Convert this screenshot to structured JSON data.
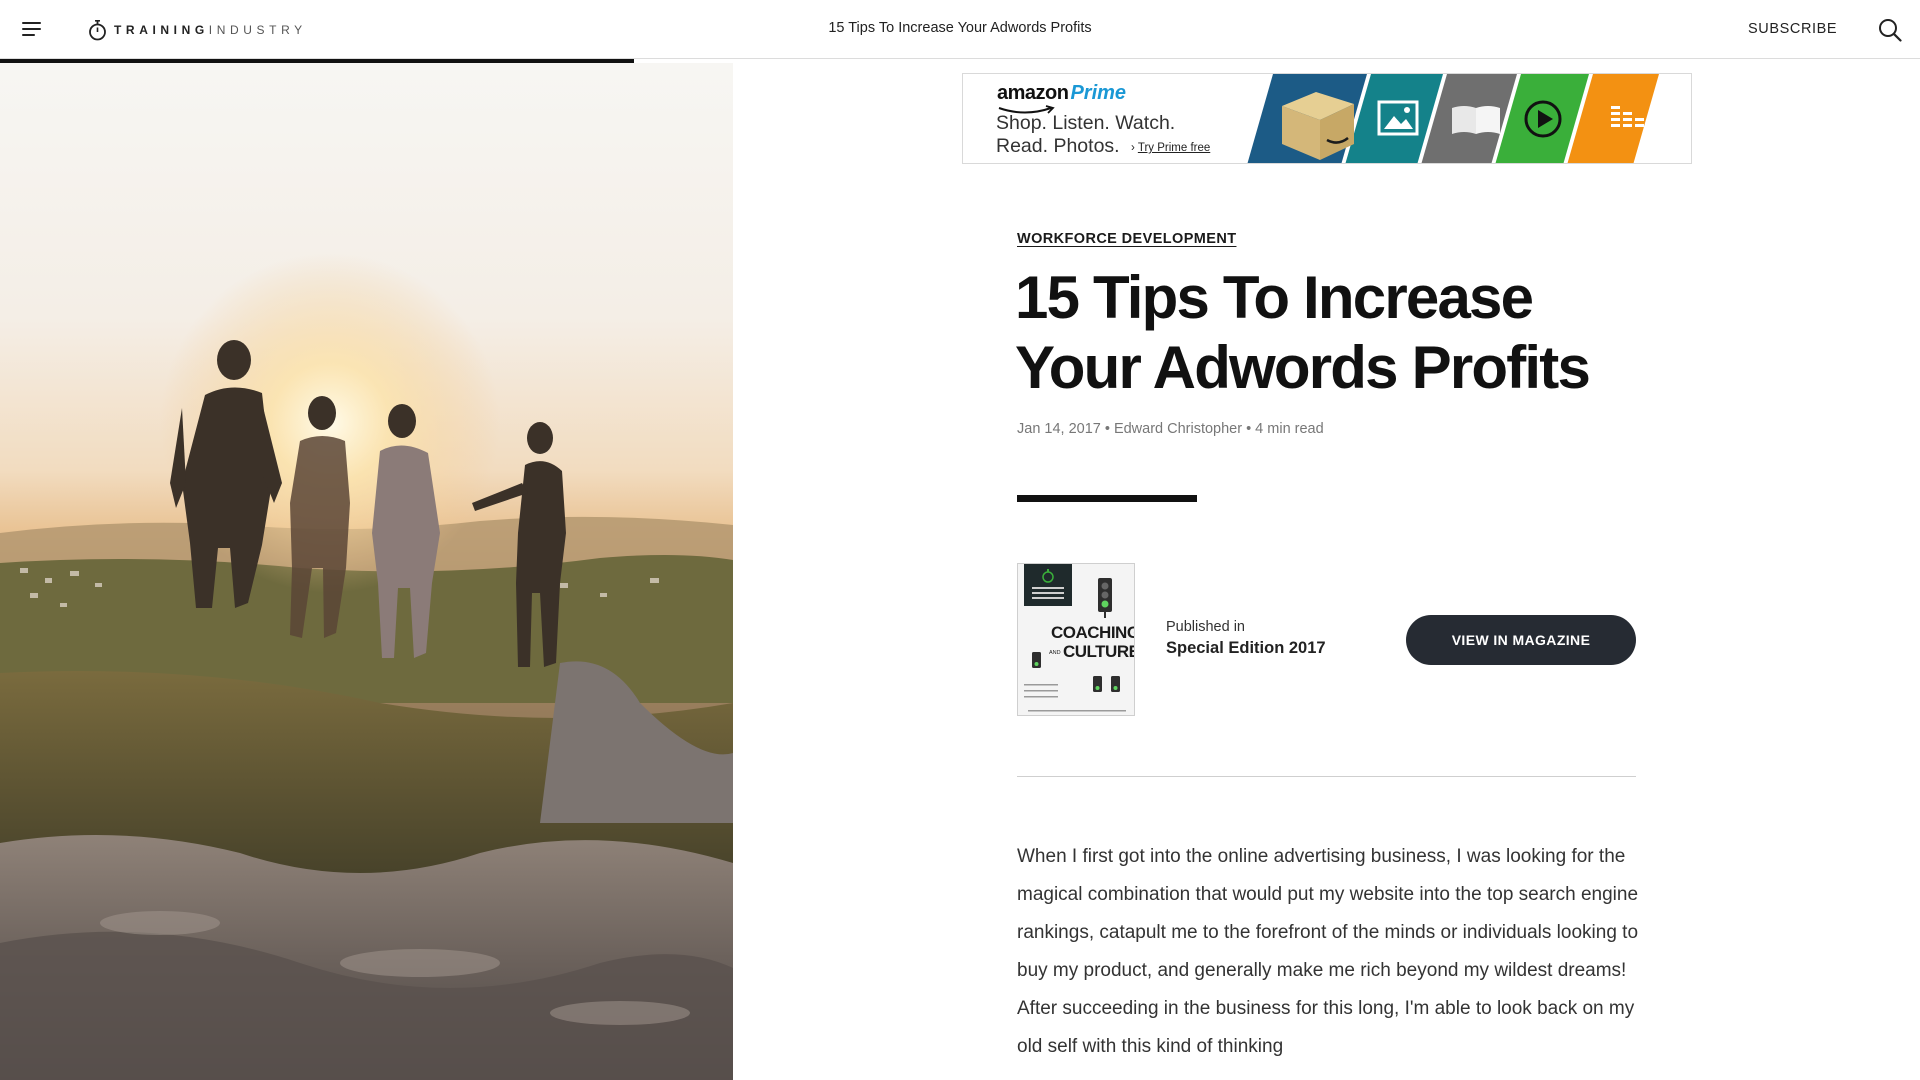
{
  "header": {
    "logo_bold": "TRAINING",
    "logo_light": "INDUSTRY",
    "article_title": "15 Tips To Increase Your Adwords Profits",
    "subscribe_label": "SUBSCRIBE",
    "reading_progress": 0.33
  },
  "ad": {
    "brand_amazon": "amazon",
    "brand_prime": "Prime",
    "line1": "Shop. Listen. Watch.",
    "line2": "Read. Photos.",
    "cta_arrow": "›",
    "cta": "Try Prime free",
    "tiles": [
      {
        "name": "box-icon",
        "color": "#1c5b86"
      },
      {
        "name": "photo-icon",
        "color": "#14828a"
      },
      {
        "name": "book-icon",
        "color": "#6f6f6f"
      },
      {
        "name": "play-icon",
        "color": "#3aaf3a"
      },
      {
        "name": "music-icon",
        "color": "#f39112"
      }
    ]
  },
  "article": {
    "category": "WORKFORCE DEVELOPMENT",
    "title": "15 Tips To Increase Your Adwords Profits",
    "date": "Jan 14, 2017",
    "separator": "•",
    "author": "Edward Christopher",
    "read_time": "4 min read"
  },
  "magazine": {
    "cover_title_1": "COACHING",
    "cover_and": "AND",
    "cover_title_2": "CULTURE",
    "published_label": "Published in",
    "edition": "Special Edition 2017",
    "button_label": "VIEW IN MAGAZINE"
  },
  "body": {
    "paragraph": "When I first got into the online advertising business, I was looking for the magical combination that would put my website into the top search engine rankings, catapult me to the forefront of the minds or individuals looking to buy my product, and generally make me rich beyond my wildest dreams! After succeeding in the business for this long, I'm able to look back on my old self with this kind of thinking"
  },
  "colors": {
    "button_bg": "#262b33",
    "prime_blue": "#1a98d5",
    "accent_green": "#3aaf3a"
  }
}
